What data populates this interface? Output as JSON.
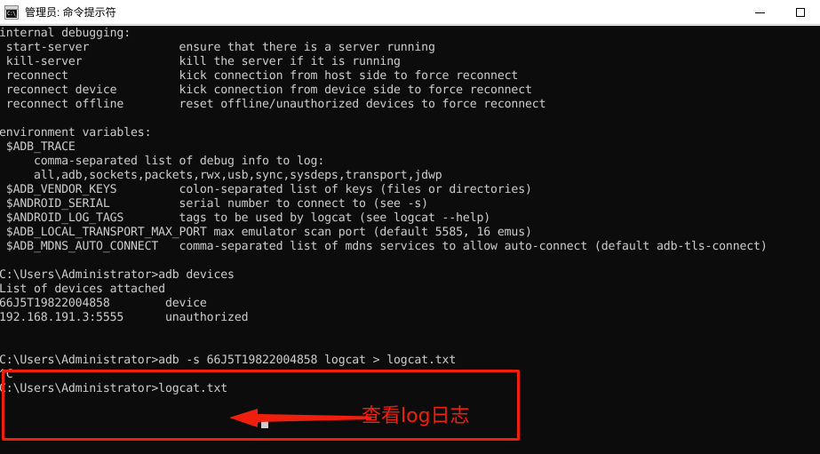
{
  "window": {
    "title": "管理员: 命令提示符",
    "icon_name": "cmd-console-icon",
    "icon_glyph": "C:\\_",
    "controls": {
      "minimize_label": "−",
      "maximize_label": "□"
    }
  },
  "console": {
    "background": "#0c0c0c",
    "foreground": "#cccccc",
    "text": "internal debugging:\n start-server             ensure that there is a server running\n kill-server              kill the server if it is running\n reconnect                kick connection from host side to force reconnect\n reconnect device         kick connection from device side to force reconnect\n reconnect offline        reset offline/unauthorized devices to force reconnect\n\nenvironment variables:\n $ADB_TRACE\n     comma-separated list of debug info to log:\n     all,adb,sockets,packets,rwx,usb,sync,sysdeps,transport,jdwp\n $ADB_VENDOR_KEYS         colon-separated list of keys (files or directories)\n $ANDROID_SERIAL          serial number to connect to (see -s)\n $ANDROID_LOG_TAGS        tags to be used by logcat (see logcat --help)\n $ADB_LOCAL_TRANSPORT_MAX_PORT max emulator scan port (default 5585, 16 emus)\n $ADB_MDNS_AUTO_CONNECT   comma-separated list of mdns services to allow auto-connect (default adb-tls-connect)\n\nC:\\Users\\Administrator>adb devices\nList of devices attached\n66J5T19822004858        device\n192.168.191.3:5555      unauthorized\n\n\nC:\\Users\\Administrator>adb -s 66J5T19822004858 logcat > logcat.txt\n^C\nC:\\Users\\Administrator>logcat.txt"
  },
  "annotation": {
    "color": "#f01e0c",
    "label": "查看log日志",
    "arrow_name": "left-pointing-arrow",
    "box_name": "highlight-rectangle"
  }
}
